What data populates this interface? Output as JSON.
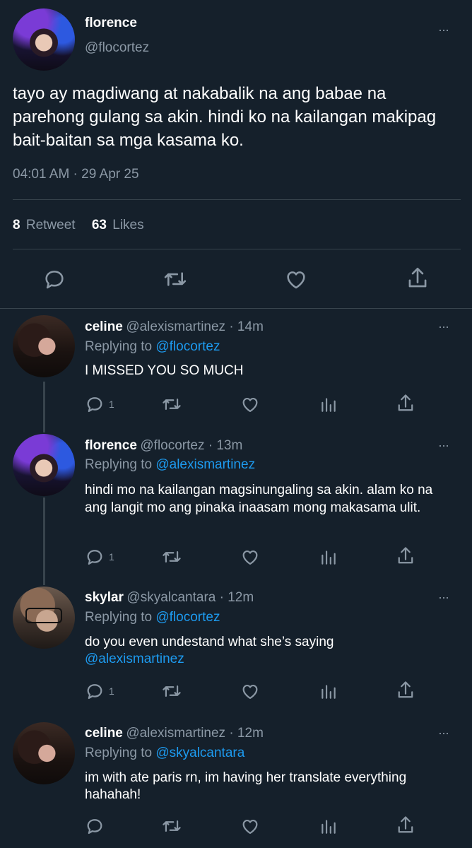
{
  "main_tweet": {
    "name": "florence",
    "handle": "@flocortez",
    "text": "tayo ay magdiwang at nakabalik na ang babae na parehong gulang sa akin. hindi ko na kailangan makipag bait-baitan sa mga kasama ko.",
    "timestamp": "04:01 AM · 29 Apr 25",
    "retweets_count": "8",
    "retweets_label": "Retweet",
    "likes_count": "63",
    "likes_label": "Likes"
  },
  "replies": [
    {
      "name": "celine",
      "meta": "@alexismartinez · 14m",
      "replying_prefix": "Replying to",
      "replying_to": "@flocortez",
      "text": "I MISSED YOU SO MUCH",
      "reply_count": "1"
    },
    {
      "name": "florence",
      "meta": "@flocortez · 13m",
      "replying_prefix": "Replying to",
      "replying_to": "@alexismartinez",
      "text": "hindi mo na kailangan magsinungaling sa akin. alam ko na ang langit mo ang pinaka inaasam mong makasama ulit.",
      "reply_count": "1"
    },
    {
      "name": "skylar",
      "meta": "@skyalcantara · 12m",
      "replying_prefix": "Replying to",
      "replying_to": "@flocortez",
      "text": "do you even undestand what she’s saying",
      "mention": "@alexismartinez",
      "reply_count": "1"
    },
    {
      "name": "celine",
      "meta": "@alexismartinez · 12m",
      "replying_prefix": "Replying to",
      "replying_to": "@skyalcantara",
      "text": "im with ate paris rn, im having her translate everything hahahah!",
      "reply_count": ""
    }
  ],
  "more_icon": "···",
  "colors": {
    "background": "#15202b",
    "text": "#ffffff",
    "muted": "#8b98a5",
    "link": "#1d9bf0",
    "divider": "#38444d"
  }
}
